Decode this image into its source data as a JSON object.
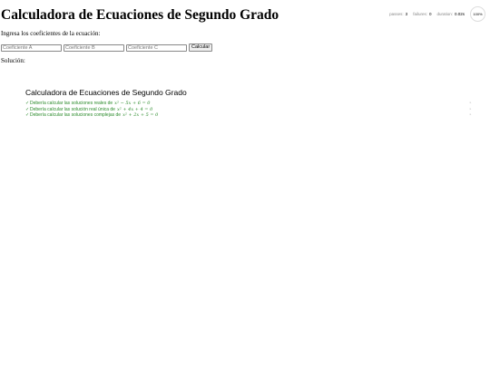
{
  "app": {
    "title": "Calculadora de Ecuaciones de Segundo Grado",
    "prompt": "Ingresa los coeficientes de la ecuación:",
    "inputs": [
      {
        "placeholder": "Coeficiente A"
      },
      {
        "placeholder": "Coeficiente B"
      },
      {
        "placeholder": "Coeficiente C"
      }
    ],
    "calculate_label": "Calcular",
    "solution_label": "Solución:"
  },
  "stats": {
    "passes_label": "passes:",
    "passes": "3",
    "failures_label": "failures:",
    "failures": "0",
    "duration_label": "duration:",
    "duration": "0.02s",
    "progress": "100%"
  },
  "report": {
    "suite_title": "Calculadora de Ecuaciones de Segundo Grado",
    "tests": [
      {
        "status": "passed",
        "text": "Debería calcular las soluciones reales de",
        "equation": "x² − 5x + 6 = 0"
      },
      {
        "status": "passed",
        "text": "Debería calcular las solución real única de",
        "equation": "x² + 4x + 4 = 0"
      },
      {
        "status": "passed",
        "text": "Debería calcular las soluciones complejas de",
        "equation": "x² + 2x + 5 = 0"
      }
    ],
    "check_glyph": "✓",
    "replay_glyph": "‣"
  },
  "colors": {
    "pass_green": "#2a8a2a"
  }
}
